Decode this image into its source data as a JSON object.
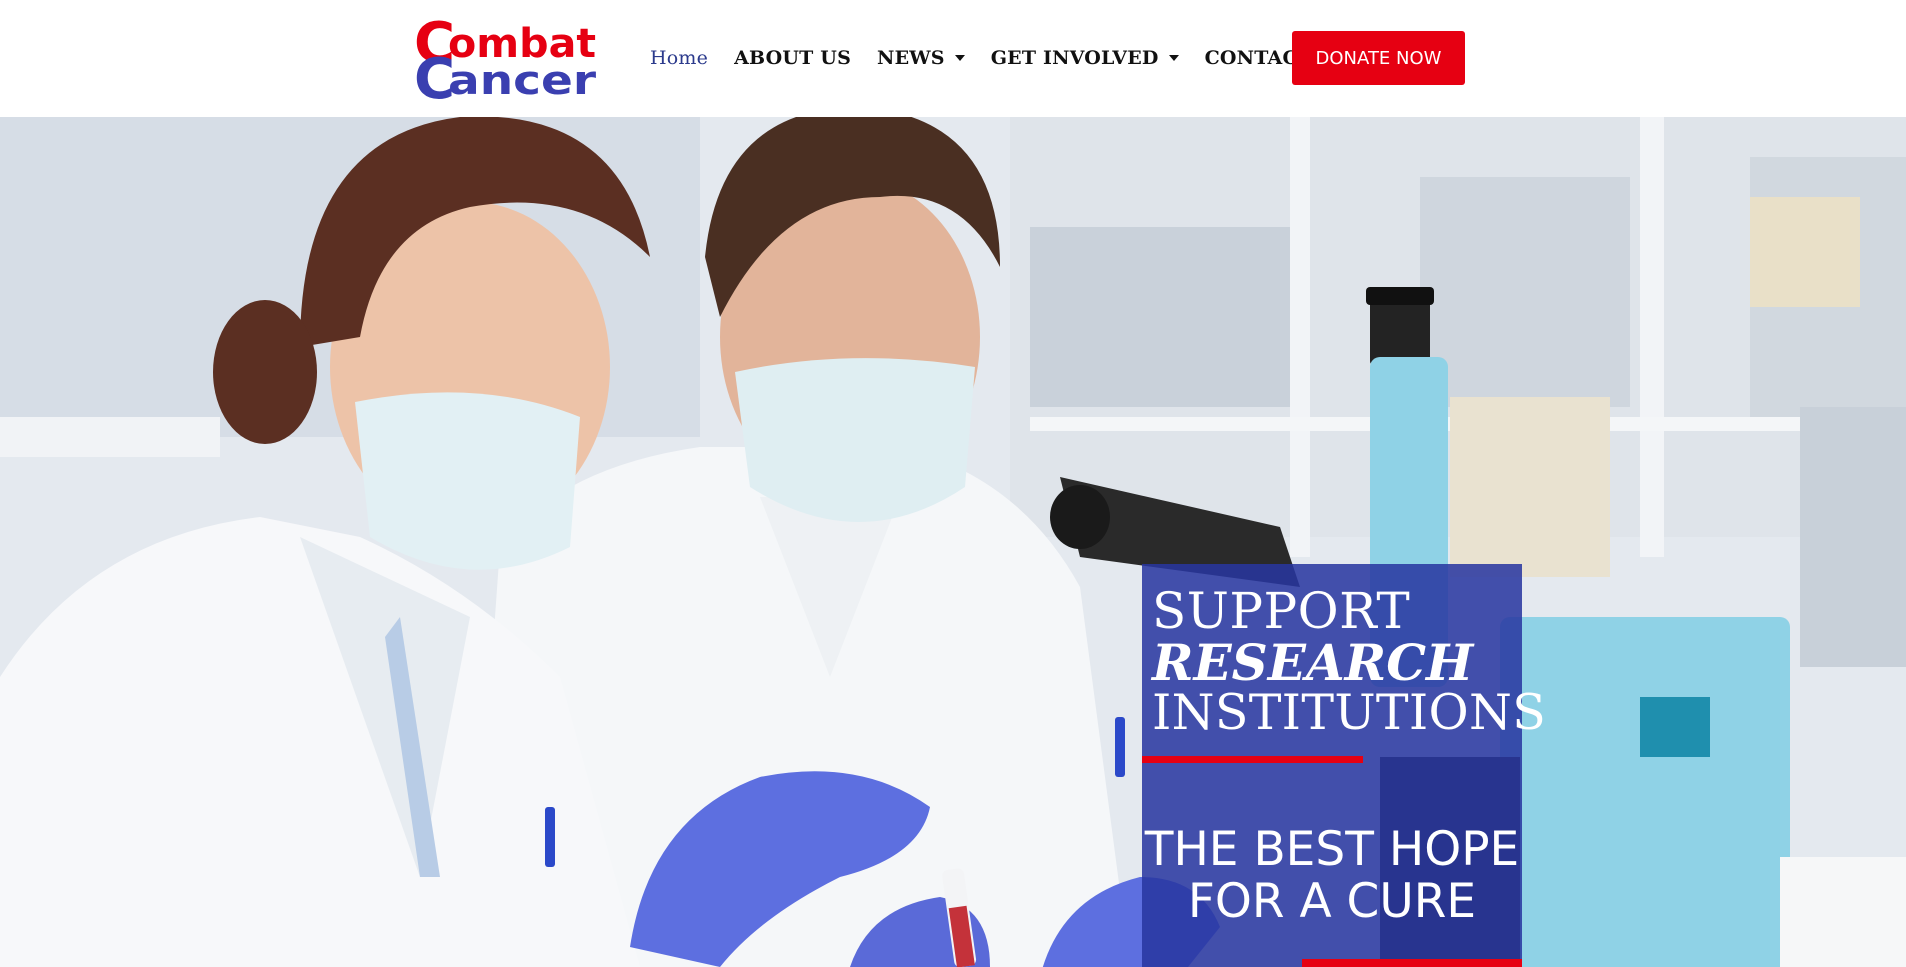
{
  "logo": {
    "line1": "Combat",
    "line2": "Cancer",
    "alt": "Combat Cancer logo"
  },
  "nav": {
    "items": [
      {
        "label": "Home",
        "active": true,
        "dropdown": false
      },
      {
        "label": "ABOUT US",
        "active": false,
        "dropdown": false
      },
      {
        "label": "NEWS",
        "active": false,
        "dropdown": true
      },
      {
        "label": "GET INVOLVED",
        "active": false,
        "dropdown": true
      },
      {
        "label": "CONTACT US",
        "active": false,
        "dropdown": false
      }
    ],
    "donate_label": "DONATE NOW"
  },
  "hero": {
    "line1": "SUPPORT",
    "line2": "RESEARCH",
    "line3": "INSTITUTIONS",
    "tagline": "THE BEST HOPE FOR A CURE"
  },
  "colors": {
    "brand_red": "#e60012",
    "brand_blue": "#2b3a8c",
    "panel_blue": "#2836a0"
  },
  "icons": {
    "dropdown": "caret-down-icon"
  }
}
